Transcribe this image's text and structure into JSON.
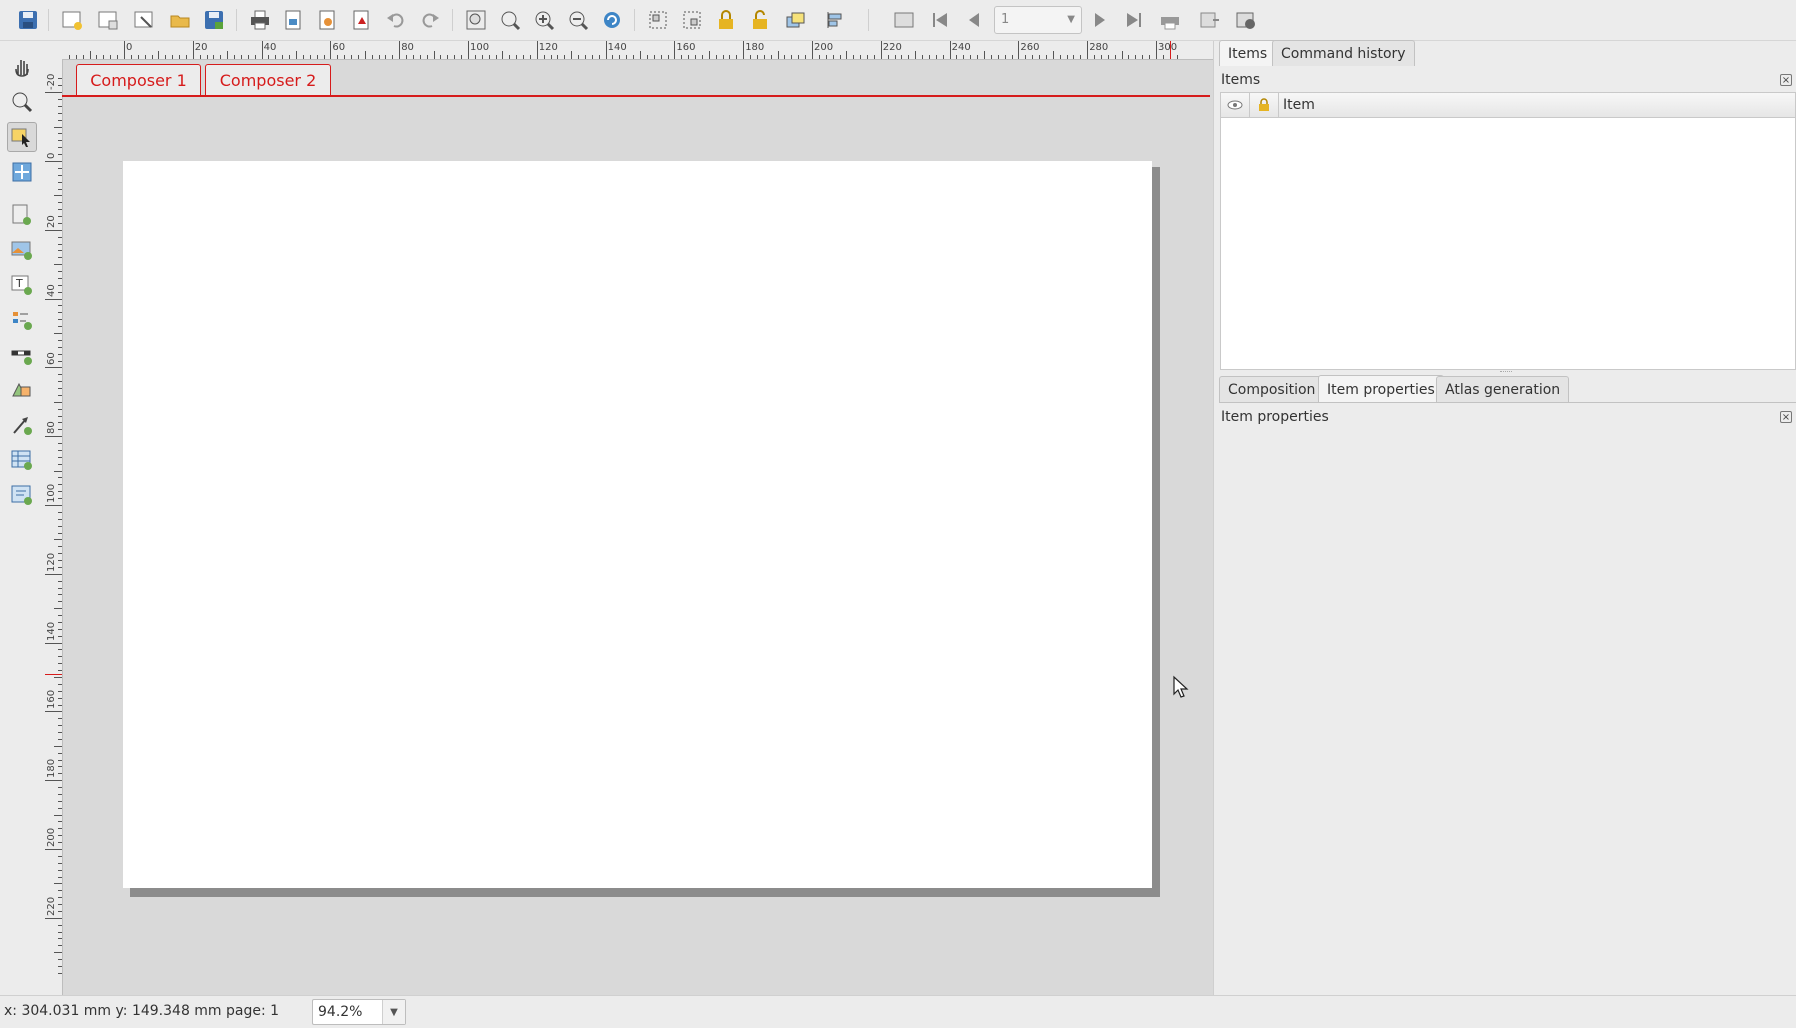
{
  "toolbar": {
    "icons": [
      "save-icon",
      "new-composer-icon",
      "duplicate-composer-icon",
      "composer-manager-icon",
      "open-template-icon",
      "save-template-icon",
      "print-icon",
      "export-image-icon",
      "export-svg-icon",
      "export-pdf-icon",
      "undo-icon",
      "redo-icon",
      "zoom-full-icon",
      "zoom-actual-icon",
      "zoom-in-icon",
      "zoom-out-icon",
      "refresh-icon",
      "group-icon",
      "ungroup-icon",
      "lock-icon",
      "unlock-icon",
      "raise-icon",
      "align-icon",
      "atlas-preview-icon",
      "first-feature-icon",
      "previous-feature-icon",
      "next-feature-icon",
      "last-feature-icon",
      "print-atlas-icon",
      "export-atlas-icon",
      "atlas-settings-icon"
    ],
    "page_value": "1"
  },
  "composer_tabs": [
    "Composer 1",
    "Composer 2"
  ],
  "ruler": {
    "h_labels": [
      "0",
      "20",
      "40",
      "60",
      "80",
      "100",
      "120",
      "140",
      "160",
      "180",
      "200",
      "220",
      "240",
      "260",
      "280",
      "300"
    ],
    "v_labels": [
      "-20",
      "0",
      "20",
      "40",
      "60",
      "80",
      "100",
      "120",
      "140",
      "160",
      "180",
      "200",
      "220"
    ]
  },
  "right_panel": {
    "top_tabs": [
      "Items",
      "Command history"
    ],
    "items_title": "Items",
    "items_header": {
      "item_column": "Item"
    },
    "bottom_tabs": [
      "Composition",
      "Item properties",
      "Atlas generation"
    ],
    "item_props_title": "Item properties"
  },
  "status": {
    "coords": "x: 304.031 mm  y: 149.348 mm  page: 1",
    "zoom": "94.2%"
  },
  "colors": {
    "accent_red": "#d61b1b",
    "canvas_bg": "#d9d9d9",
    "paper": "#ffffff"
  }
}
